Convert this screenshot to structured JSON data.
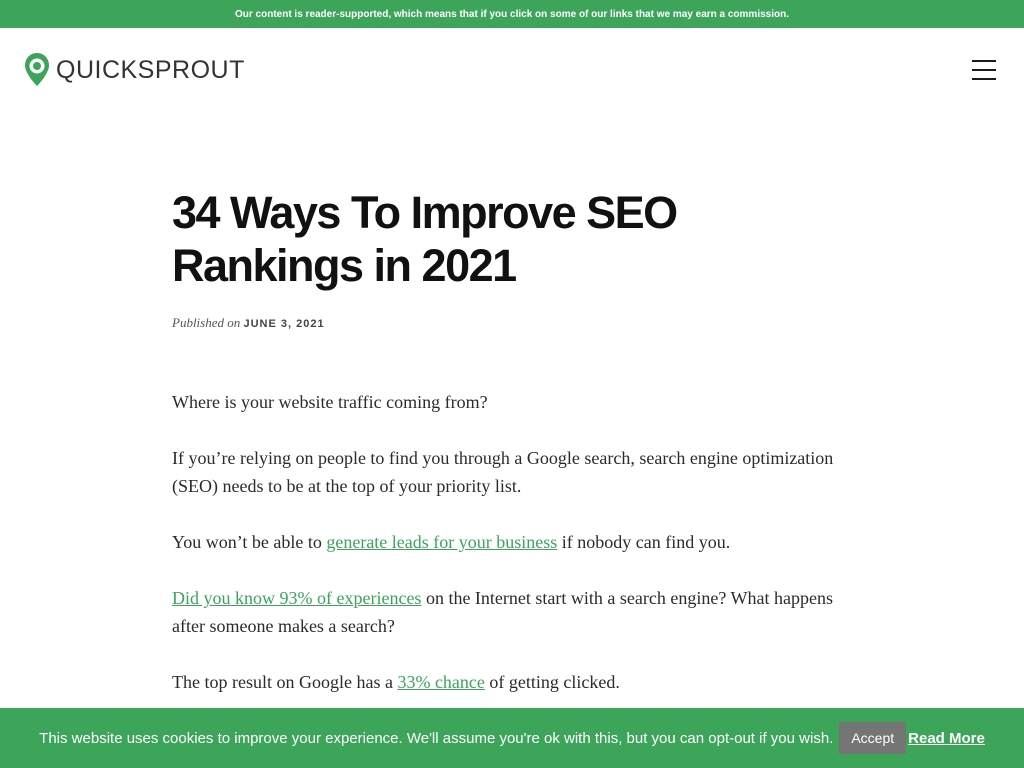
{
  "disclosure": "Our content is reader-supported, which means that if you click on some of our links that we may earn a commission.",
  "header": {
    "logo_text": "QUICKSPROUT",
    "menu_icon": "hamburger-menu-icon",
    "brand_color": "#3da55a"
  },
  "article": {
    "title": "34 Ways To Improve SEO Rankings in 2021",
    "published_label": "Published on",
    "date": "JUNE 3, 2021",
    "paragraphs": [
      {
        "text": "Where is your website traffic coming from?"
      },
      {
        "text": "If you’re relying on people to find you through a Google search, search engine optimization (SEO) needs to be at the top of your priority list."
      },
      {
        "before": "You won’t be able to ",
        "link": "generate leads for your business",
        "after": " if nobody can find you."
      },
      {
        "before": "",
        "link": "Did you know 93% of experiences",
        "after": " on the Internet start with a search engine? What happens after someone makes a search?"
      },
      {
        "before": "The top result on Google has a ",
        "link": "33% chance",
        "after": " of getting clicked."
      }
    ]
  },
  "cookie_bar": {
    "text": "This website uses cookies to improve your experience. We'll assume you're ok with this, but you can opt-out if you wish.",
    "accept_label": "Accept",
    "read_more_label": "Read More"
  }
}
